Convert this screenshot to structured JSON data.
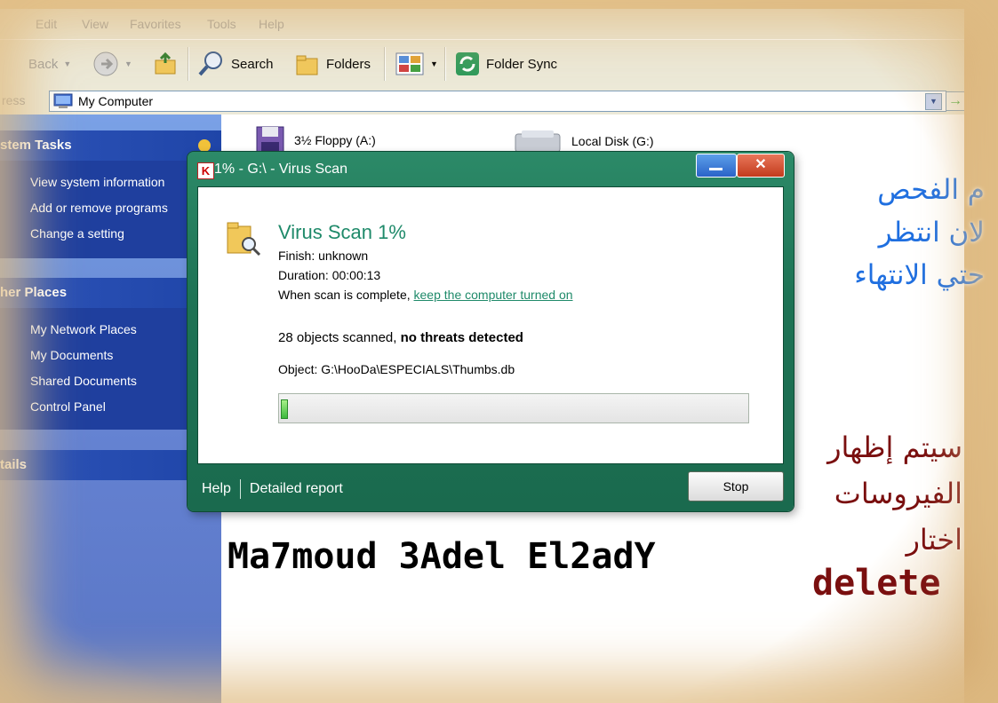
{
  "menu": [
    "Edit",
    "View",
    "Favorites",
    "Tools",
    "Help"
  ],
  "toolbar": {
    "back": "Back",
    "search": "Search",
    "folders": "Folders",
    "folder_sync": "Folder Sync"
  },
  "address": {
    "label": "ress",
    "value": "My Computer",
    "go": "Go"
  },
  "sidebar": {
    "system_tasks": {
      "title": "stem Tasks",
      "items": [
        "View system information",
        "Add or remove programs",
        "Change a setting"
      ]
    },
    "other_places": {
      "title": "her Places",
      "items": [
        "My Network Places",
        "My Documents",
        "Shared Documents",
        "Control Panel"
      ]
    },
    "details": {
      "title": "tails"
    }
  },
  "drives": [
    {
      "label": "3½ Floppy (A:)",
      "icon": "floppy-icon"
    },
    {
      "label": "Local Disk (G:)",
      "icon": "hard-disk-icon"
    }
  ],
  "dialog": {
    "title": "1% - G:\\ - Virus Scan",
    "heading": "Virus Scan 1%",
    "finish": "Finish: unknown",
    "duration": "Duration: 00:00:13",
    "complete_prefix": "When scan is complete, ",
    "complete_link": "keep the computer turned on",
    "objects_prefix": "28 objects scanned, ",
    "objects_bold": "no threats detected",
    "object_path": "Object: G:\\HooDa\\ESPECIALS\\Thumbs.db",
    "progress": 0.01,
    "help": "Help",
    "detailed_report": "Detailed report",
    "stop": "Stop",
    "accent_color": "#1e7355"
  },
  "overlay": {
    "blue_lines": [
      "م   الفحص",
      "لان   انتظر",
      "حتي   الانتهاء"
    ],
    "red_lines": [
      "سيتم   إظهار",
      "الفيروسات",
      "اختار"
    ],
    "delete_word": "delete",
    "signature": "Ma7moud 3Adel El2adY"
  }
}
